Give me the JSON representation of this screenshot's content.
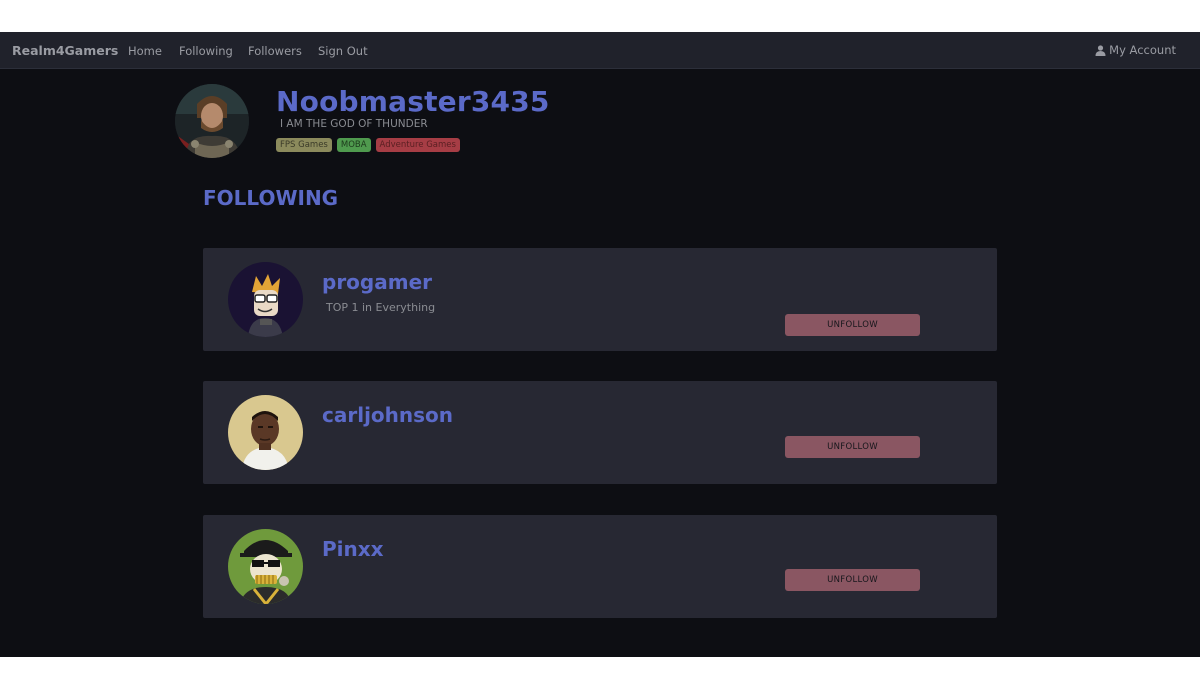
{
  "nav": {
    "brand": "Realm4Gamers",
    "links": [
      "Home",
      "Following",
      "Followers",
      "Sign Out"
    ],
    "account_label": "My Account",
    "account_icon": "user-icon"
  },
  "profile": {
    "username": "Noobmaster3435",
    "bio": "I AM THE GOD OF THUNDER",
    "tags": [
      {
        "label": "FPS Games",
        "bg": "#8b8a5c",
        "fg": "#3a3a28"
      },
      {
        "label": "MOBA",
        "bg": "#4f9a4e",
        "fg": "#1d3a1c"
      },
      {
        "label": "Adventure Games",
        "bg": "#a63d45",
        "fg": "#5a1f22"
      }
    ]
  },
  "section_title": "FOLLOWING",
  "following": [
    {
      "name": "progamer",
      "bio": "TOP 1 in Everything",
      "action": "UNFOLLOW"
    },
    {
      "name": "carljohnson",
      "bio": "",
      "action": "UNFOLLOW"
    },
    {
      "name": "Pinxx",
      "bio": "",
      "action": "UNFOLLOW"
    }
  ],
  "colors": {
    "accent": "#5b6ac8",
    "background": "#0d0e13",
    "card": "#272833",
    "navbar": "#20222b",
    "unfollow_button": "#8a5662"
  }
}
